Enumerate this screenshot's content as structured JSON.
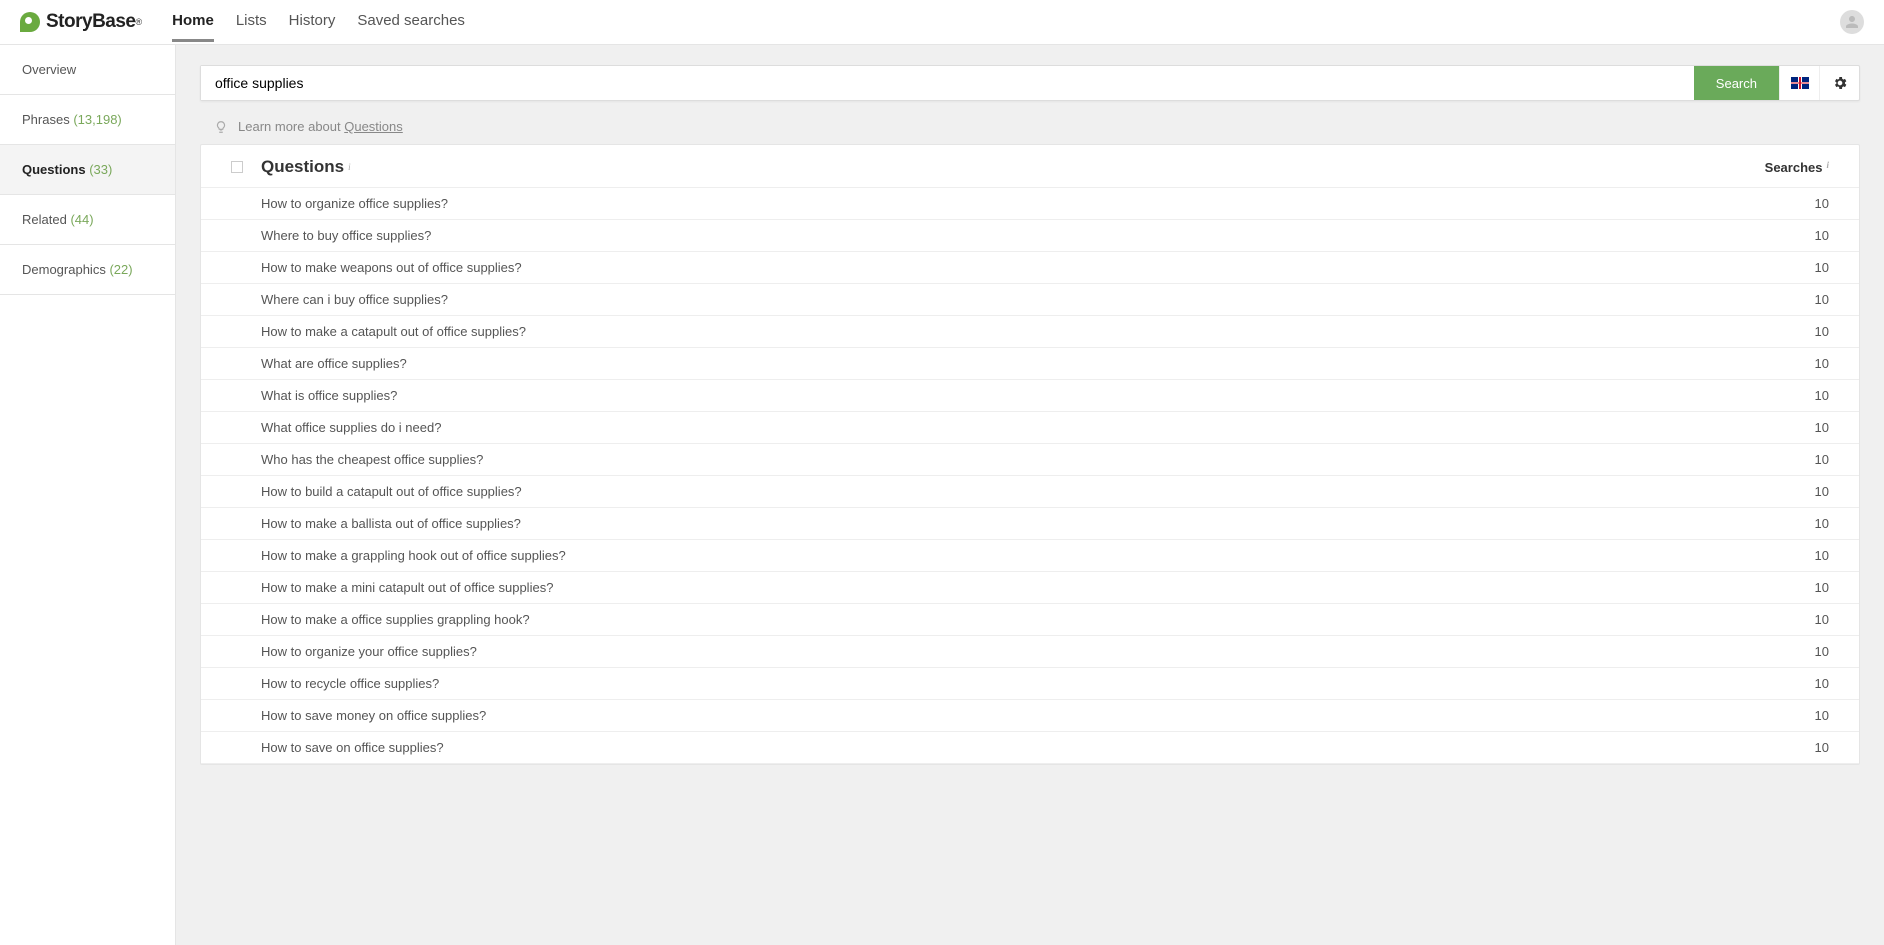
{
  "brand": "StoryBase",
  "nav": {
    "home": "Home",
    "lists": "Lists",
    "history": "History",
    "saved": "Saved searches"
  },
  "search": {
    "value": "office supplies",
    "button": "Search"
  },
  "hint": {
    "prefix": "Learn more about ",
    "link": "Questions"
  },
  "sidebar": {
    "overview": {
      "label": "Overview"
    },
    "phrases": {
      "label": "Phrases",
      "count": "(13,198)"
    },
    "questions": {
      "label": "Questions",
      "count": "(33)"
    },
    "related": {
      "label": "Related",
      "count": "(44)"
    },
    "demographics": {
      "label": "Demographics",
      "count": "(22)"
    }
  },
  "table": {
    "title": "Questions",
    "searches_header": "Searches",
    "rows": [
      {
        "q": "How to organize office supplies?",
        "s": "10"
      },
      {
        "q": "Where to buy office supplies?",
        "s": "10"
      },
      {
        "q": "How to make weapons out of office supplies?",
        "s": "10"
      },
      {
        "q": "Where can i buy office supplies?",
        "s": "10"
      },
      {
        "q": "How to make a catapult out of office supplies?",
        "s": "10"
      },
      {
        "q": "What are office supplies?",
        "s": "10"
      },
      {
        "q": "What is office supplies?",
        "s": "10"
      },
      {
        "q": "What office supplies do i need?",
        "s": "10"
      },
      {
        "q": "Who has the cheapest office supplies?",
        "s": "10"
      },
      {
        "q": "How to build a catapult out of office supplies?",
        "s": "10"
      },
      {
        "q": "How to make a ballista out of office supplies?",
        "s": "10"
      },
      {
        "q": "How to make a grappling hook out of office supplies?",
        "s": "10"
      },
      {
        "q": "How to make a mini catapult out of office supplies?",
        "s": "10"
      },
      {
        "q": "How to make a office supplies grappling hook?",
        "s": "10"
      },
      {
        "q": "How to organize your office supplies?",
        "s": "10"
      },
      {
        "q": "How to recycle office supplies?",
        "s": "10"
      },
      {
        "q": "How to save money on office supplies?",
        "s": "10"
      },
      {
        "q": "How to save on office supplies?",
        "s": "10"
      }
    ]
  }
}
